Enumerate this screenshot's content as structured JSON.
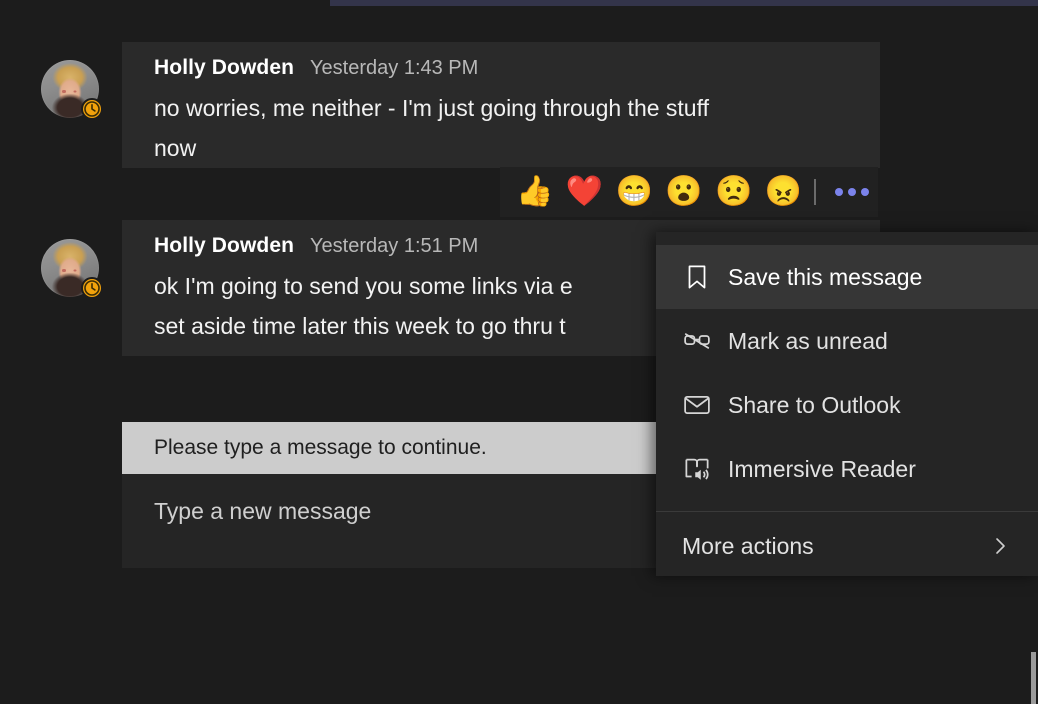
{
  "window": {
    "background_color": "#1c1c1c",
    "accent_strip_color": "#33344a"
  },
  "messages": [
    {
      "sender": "Holly Dowden",
      "timestamp": "Yesterday 1:43 PM",
      "body": "no worries, me neither - I'm just going through the stuff\nnow",
      "avatar_status": "away",
      "avatar_status_icon": "clock-icon"
    },
    {
      "sender": "Holly Dowden",
      "timestamp": "Yesterday 1:51 PM",
      "body": "ok I'm going to send you some links via e\nset aside time later this week to go thru t",
      "avatar_status": "away",
      "avatar_status_icon": "clock-icon"
    }
  ],
  "reaction_bar": {
    "reactions": [
      {
        "name": "thumbs-up-reaction",
        "glyph": "👍"
      },
      {
        "name": "heart-reaction",
        "glyph": "❤️"
      },
      {
        "name": "laugh-reaction",
        "glyph": "😁"
      },
      {
        "name": "surprised-reaction",
        "glyph": "😮"
      },
      {
        "name": "sad-reaction",
        "glyph": "😟"
      },
      {
        "name": "angry-reaction",
        "glyph": "😠"
      }
    ],
    "more_options_label": "More options",
    "more_options_color": "#7b83eb"
  },
  "context_menu": {
    "items": [
      {
        "label": "Save this message",
        "icon": "bookmark-icon",
        "highlighted": true
      },
      {
        "label": "Mark as unread",
        "icon": "glasses-slash-icon",
        "highlighted": false
      },
      {
        "label": "Share to Outlook",
        "icon": "envelope-icon",
        "highlighted": false
      },
      {
        "label": "Immersive Reader",
        "icon": "immersive-reader-icon",
        "highlighted": false
      }
    ],
    "submenu": {
      "label": "More actions",
      "icon": "chevron-right-icon"
    },
    "highlight_color": "#363636"
  },
  "compose": {
    "validation_message": "Please type a message to continue.",
    "placeholder": "Type a new message",
    "value": ""
  }
}
